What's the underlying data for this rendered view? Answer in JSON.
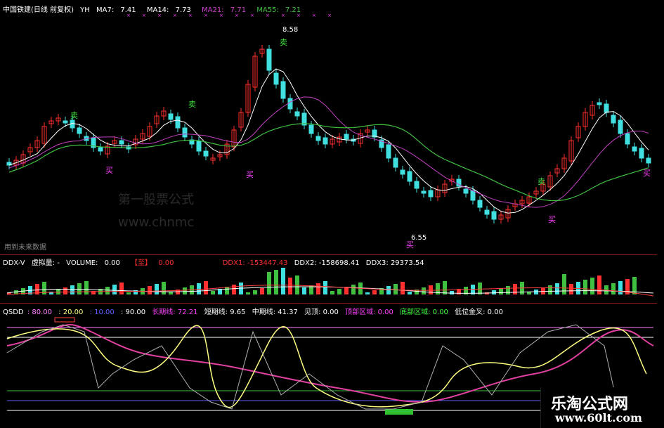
{
  "main": {
    "title": "中国铁建(日线 前复权)",
    "suffix": "YH",
    "ma": [
      {
        "label": "MA7:",
        "value": "7.41",
        "color": "#ffffff"
      },
      {
        "label": "MA14:",
        "value": "7.73",
        "color": "#ffffff"
      },
      {
        "label": "MA21:",
        "value": "7.71",
        "color": "#d040d0"
      },
      {
        "label": "MA55:",
        "value": "7.21",
        "color": "#40c040"
      }
    ],
    "high_label": "8.58",
    "low_label": "6.55",
    "sell_label": "卖",
    "buy_label": "买",
    "watermark1": "第一股票公式",
    "watermark2": "www.chnmc",
    "footer": "用到未来数据"
  },
  "ddx": {
    "title": "DDX-V",
    "volume_type": "虚拟量: -",
    "volume_label": "VOLUME:",
    "volume_value": "0.00",
    "tag": "【至】",
    "tag_value": "0.00",
    "ddx1": "DDX1: -153447.43",
    "ddx2": "DDX2: -158698.41",
    "ddx3": "DDX3: 29373.54"
  },
  "qsdd": {
    "title": "QSDD",
    "v80": ": 80.00",
    "v20": ": 20.00",
    "v10": ": 10.00",
    "v90": ": 90.00",
    "long": "长期线: 72.21",
    "short": "短期线: 9.65",
    "mid": "中期线: 41.37",
    "top_seen": "见顶: 0.00",
    "top_zone": "顶部区域: 0.00",
    "bottom_zone": "底部区域: 0.00",
    "golden": "低位金叉: 0.00"
  },
  "brand": {
    "name": "乐淘公式网",
    "url": "www.60lt.com"
  },
  "colors": {
    "up": "#ff3030",
    "down": "#40e0e0",
    "ma7": "#ffffff",
    "ma21": "#c040c0",
    "ma55": "#40c040",
    "yellow": "#ffff80",
    "magenta": "#e040a0",
    "gray": "#b0b0b0"
  }
}
